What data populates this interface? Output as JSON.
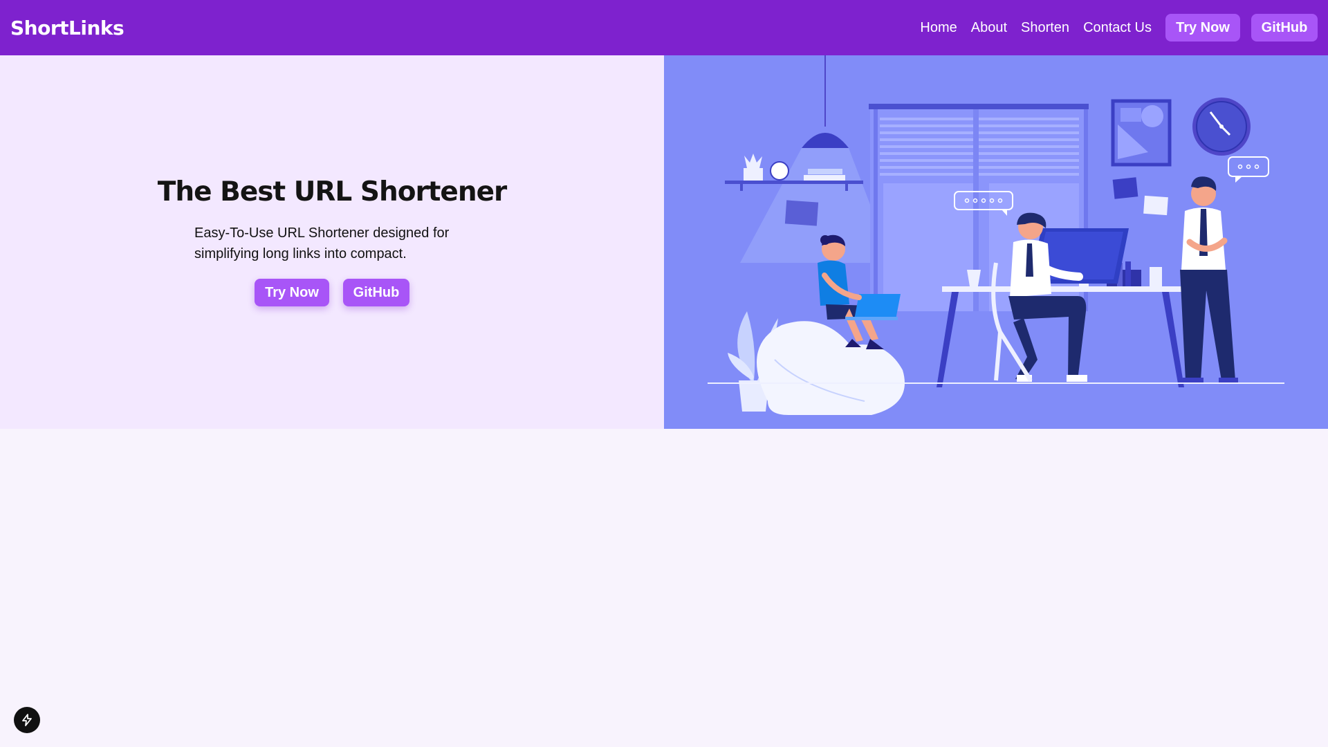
{
  "brand": "ShortLinks",
  "nav": {
    "links": [
      {
        "label": "Home"
      },
      {
        "label": "About"
      },
      {
        "label": "Shorten"
      },
      {
        "label": "Contact Us"
      }
    ],
    "try_label": "Try Now",
    "github_label": "GitHub"
  },
  "hero": {
    "title": "The Best URL Shortener",
    "description": "Easy-To-Use URL Shortener designed for simplifying long links into compact.",
    "try_label": "Try Now",
    "github_label": "GitHub",
    "illustration": "office-workers-illustration"
  },
  "badge": {
    "icon": "bolt-icon"
  },
  "colors": {
    "navbar": "#7e22ce",
    "button": "#a855f7",
    "hero_left_bg": "#f3e8ff",
    "hero_right_bg": "#818cf8",
    "page_bg": "#f8f3fd"
  }
}
